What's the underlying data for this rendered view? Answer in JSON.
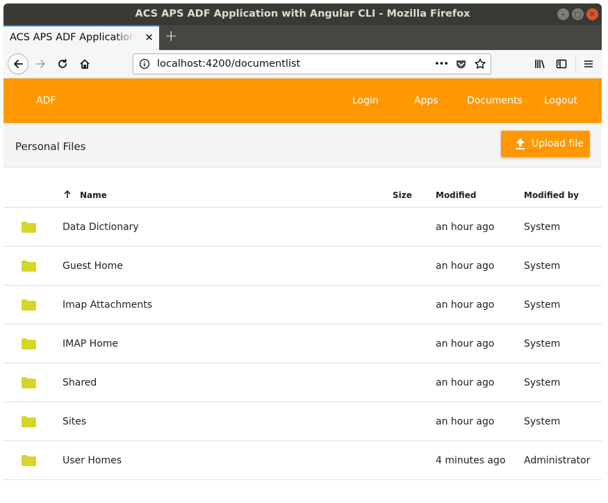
{
  "window": {
    "title": "ACS APS ADF Application with Angular CLI - Mozilla Firefox",
    "tab_label": "ACS APS ADF Application with Angular CLI",
    "tab_close": "✕",
    "new_tab": "+"
  },
  "navbar": {
    "url": "localhost:4200/documentlist",
    "page_actions": "•••"
  },
  "app": {
    "brand": "ADF",
    "nav": [
      "Login",
      "Apps",
      "Documents",
      "Logout"
    ]
  },
  "toolbar": {
    "breadcrumb": "Personal Files",
    "upload_label": "Upload file"
  },
  "table": {
    "columns": {
      "name": "Name",
      "size": "Size",
      "modified": "Modified",
      "modified_by": "Modified by"
    },
    "sort": "ascending",
    "rows": [
      {
        "name": "Data Dictionary",
        "size": "",
        "modified": "an hour ago",
        "modified_by": "System"
      },
      {
        "name": "Guest Home",
        "size": "",
        "modified": "an hour ago",
        "modified_by": "System"
      },
      {
        "name": "Imap Attachments",
        "size": "",
        "modified": "an hour ago",
        "modified_by": "System"
      },
      {
        "name": "IMAP Home",
        "size": "",
        "modified": "an hour ago",
        "modified_by": "System"
      },
      {
        "name": "Shared",
        "size": "",
        "modified": "an hour ago",
        "modified_by": "System"
      },
      {
        "name": "Sites",
        "size": "",
        "modified": "an hour ago",
        "modified_by": "System"
      },
      {
        "name": "User Homes",
        "size": "",
        "modified": "4 minutes ago",
        "modified_by": "Administrator"
      }
    ]
  },
  "colors": {
    "accent": "#ff9800",
    "folder": "#d6d62a",
    "titlebar": "#3a3934"
  }
}
